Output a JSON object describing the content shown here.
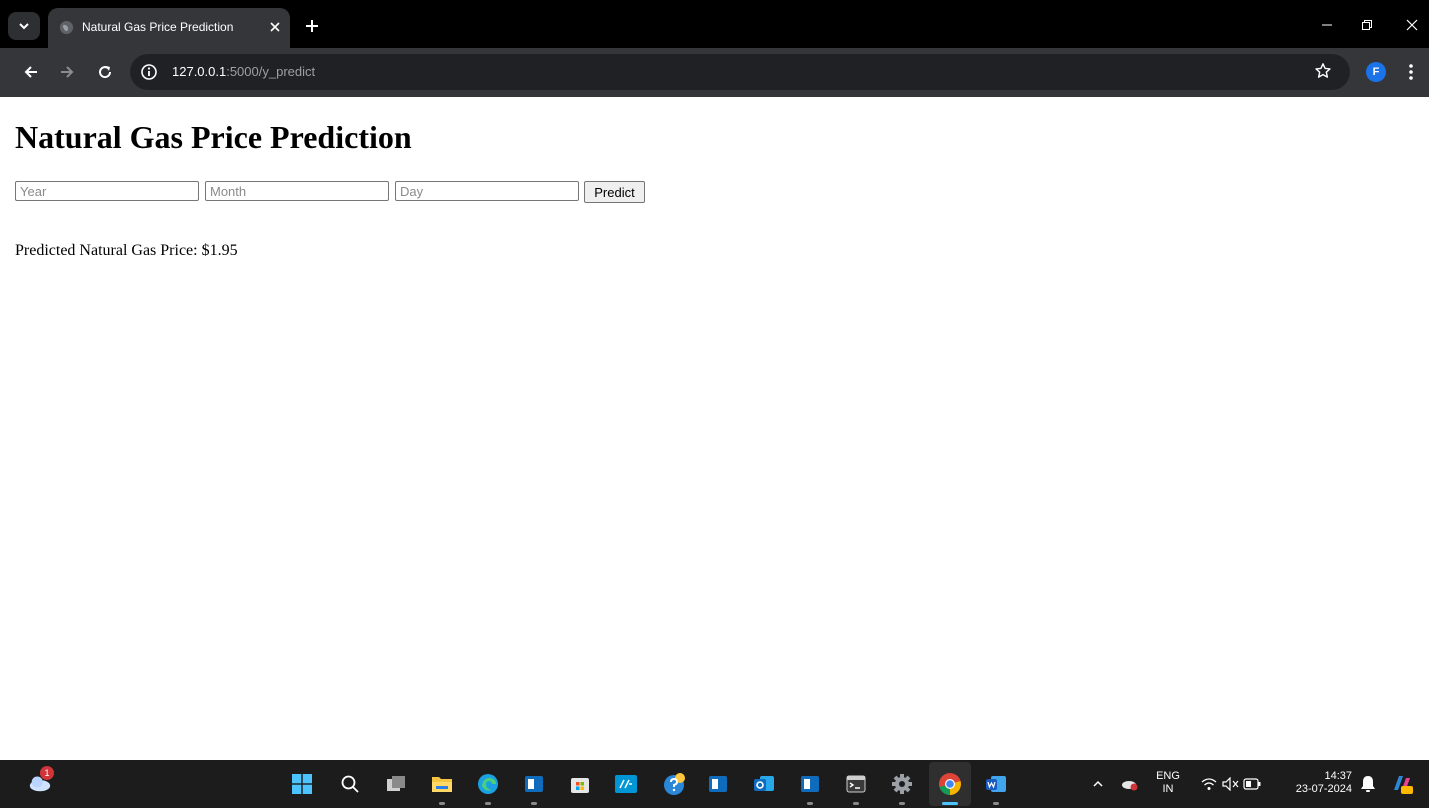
{
  "browser": {
    "tab": {
      "title": "Natural Gas Price Prediction",
      "favicon": "globe-icon"
    },
    "address": {
      "host": "127.0.0.1",
      "path": ":5000/y_predict"
    },
    "profile_initial": "F"
  },
  "page": {
    "title": "Natural Gas Price Prediction",
    "form": {
      "year": {
        "placeholder": "Year",
        "value": ""
      },
      "month": {
        "placeholder": "Month",
        "value": ""
      },
      "day": {
        "placeholder": "Day",
        "value": ""
      },
      "submit_label": "Predict"
    },
    "result_text": "Predicted Natural Gas Price: $1.95"
  },
  "taskbar": {
    "weather_badge": "1",
    "apps": [
      "windows-start-icon",
      "search-icon",
      "task-view-icon",
      "file-explorer-icon",
      "edge-icon",
      "app-icon",
      "store-icon",
      "myhp-icon",
      "help-icon",
      "app-icon",
      "outlook-icon",
      "app-icon",
      "terminal-icon",
      "settings-icon",
      "chrome-icon",
      "word-icon"
    ],
    "tray": {
      "lang_top": "ENG",
      "lang_bottom": "IN",
      "time": "14:37",
      "date": "23-07-2024"
    }
  },
  "colors": {
    "tabbar_bg": "#000000",
    "toolbar_bg": "#35363a",
    "omnibox_bg": "#202124",
    "taskbar_bg": "#1c1c1c",
    "accent": "#1a73e8"
  }
}
